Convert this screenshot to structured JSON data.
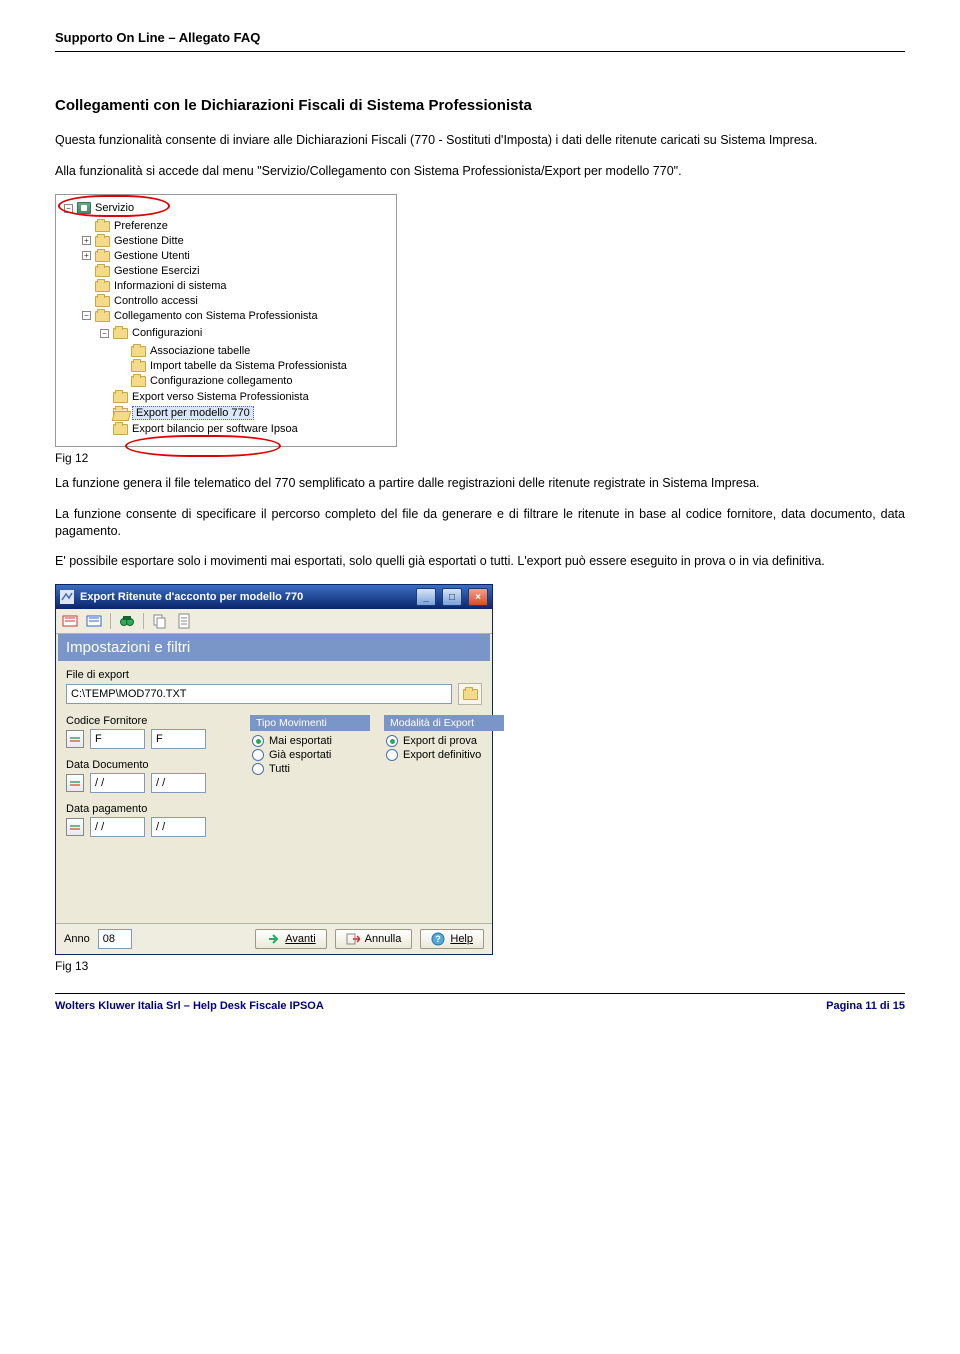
{
  "header": {
    "title": "Supporto On Line – Allegato FAQ"
  },
  "section_title": "Collegamenti con le Dichiarazioni Fiscali di Sistema Professionista",
  "para1": "Questa funzionalità consente di inviare alle Dichiarazioni Fiscali (770 - Sostituti d'Imposta) i dati delle ritenute caricati su Sistema Impresa.",
  "para2": "Alla funzionalità si accede dal menu \"Servizio/Collegamento con Sistema Professionista/Export per modello 770\".",
  "tree": {
    "root": "Servizio",
    "items": [
      "Preferenze",
      "Gestione Ditte",
      "Gestione Utenti",
      "Gestione Esercizi",
      "Informazioni di sistema",
      "Controllo accessi",
      "Collegamento con Sistema Professionista"
    ],
    "sub_config": "Configurazioni",
    "sub_config_items": [
      "Associazione tabelle",
      "Import tabelle da Sistema Professionista",
      "Configurazione collegamento"
    ],
    "export_sp": "Export verso Sistema Professionista",
    "export_770": "Export per modello 770",
    "export_bil": "Export bilancio per software Ipsoa"
  },
  "fig12": "Fig 12",
  "para3": "La funzione genera il file telematico del 770 semplificato a partire dalle registrazioni delle ritenute registrate in Sistema Impresa.",
  "para4": "La funzione consente di specificare il percorso completo del file da generare e di filtrare le ritenute in base al codice fornitore, data documento, data pagamento.",
  "para5": "E' possibile esportare solo i movimenti mai esportati, solo quelli già esportati o tutti. L'export può essere eseguito in prova o in via definitiva.",
  "dialog": {
    "title": "Export Ritenute d'acconto per modello 770",
    "band": "Impostazioni e filtri",
    "file_label": "File di export",
    "file_value": "C:\\TEMP\\MOD770.TXT",
    "codforn_label": "Codice Fornitore",
    "codforn_from": "F",
    "codforn_to": "F",
    "datadoc_label": "Data Documento",
    "datadoc_from": "/ /",
    "datadoc_to": "/ /",
    "datapag_label": "Data pagamento",
    "datapag_from": "/ /",
    "datapag_to": "/ /",
    "tipo_head": "Tipo Movimenti",
    "tipo_opts": [
      "Mai esportati",
      "Già esportati",
      "Tutti"
    ],
    "mod_head": "Modalità di Export",
    "mod_opts": [
      "Export di prova",
      "Export definitivo"
    ],
    "anno_label": "Anno",
    "anno_value": "08",
    "btn_avanti": "Avanti",
    "btn_annulla": "Annulla",
    "btn_help": "Help"
  },
  "fig13": "Fig 13",
  "footer": {
    "left": "Wolters Kluwer Italia Srl – Help Desk Fiscale IPSOA",
    "right": "Pagina 11 di 15"
  }
}
